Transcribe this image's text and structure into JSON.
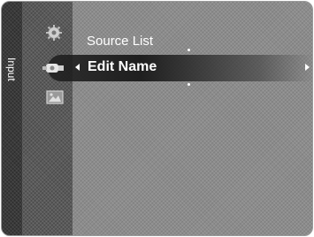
{
  "sidebar": {
    "label": "Input"
  },
  "menu": {
    "items": [
      {
        "label": "Source List",
        "icon": "gear-icon",
        "selected": false
      },
      {
        "label": "Edit Name",
        "icon": "input-plug-icon",
        "selected": true
      }
    ],
    "extra_icon": "picture-icon"
  },
  "colors": {
    "selected_bg": "#1e1e1e",
    "panel_bg": "#8c8c8c",
    "sidebar_bg": "#3a3a3a",
    "text": "#ffffff"
  }
}
